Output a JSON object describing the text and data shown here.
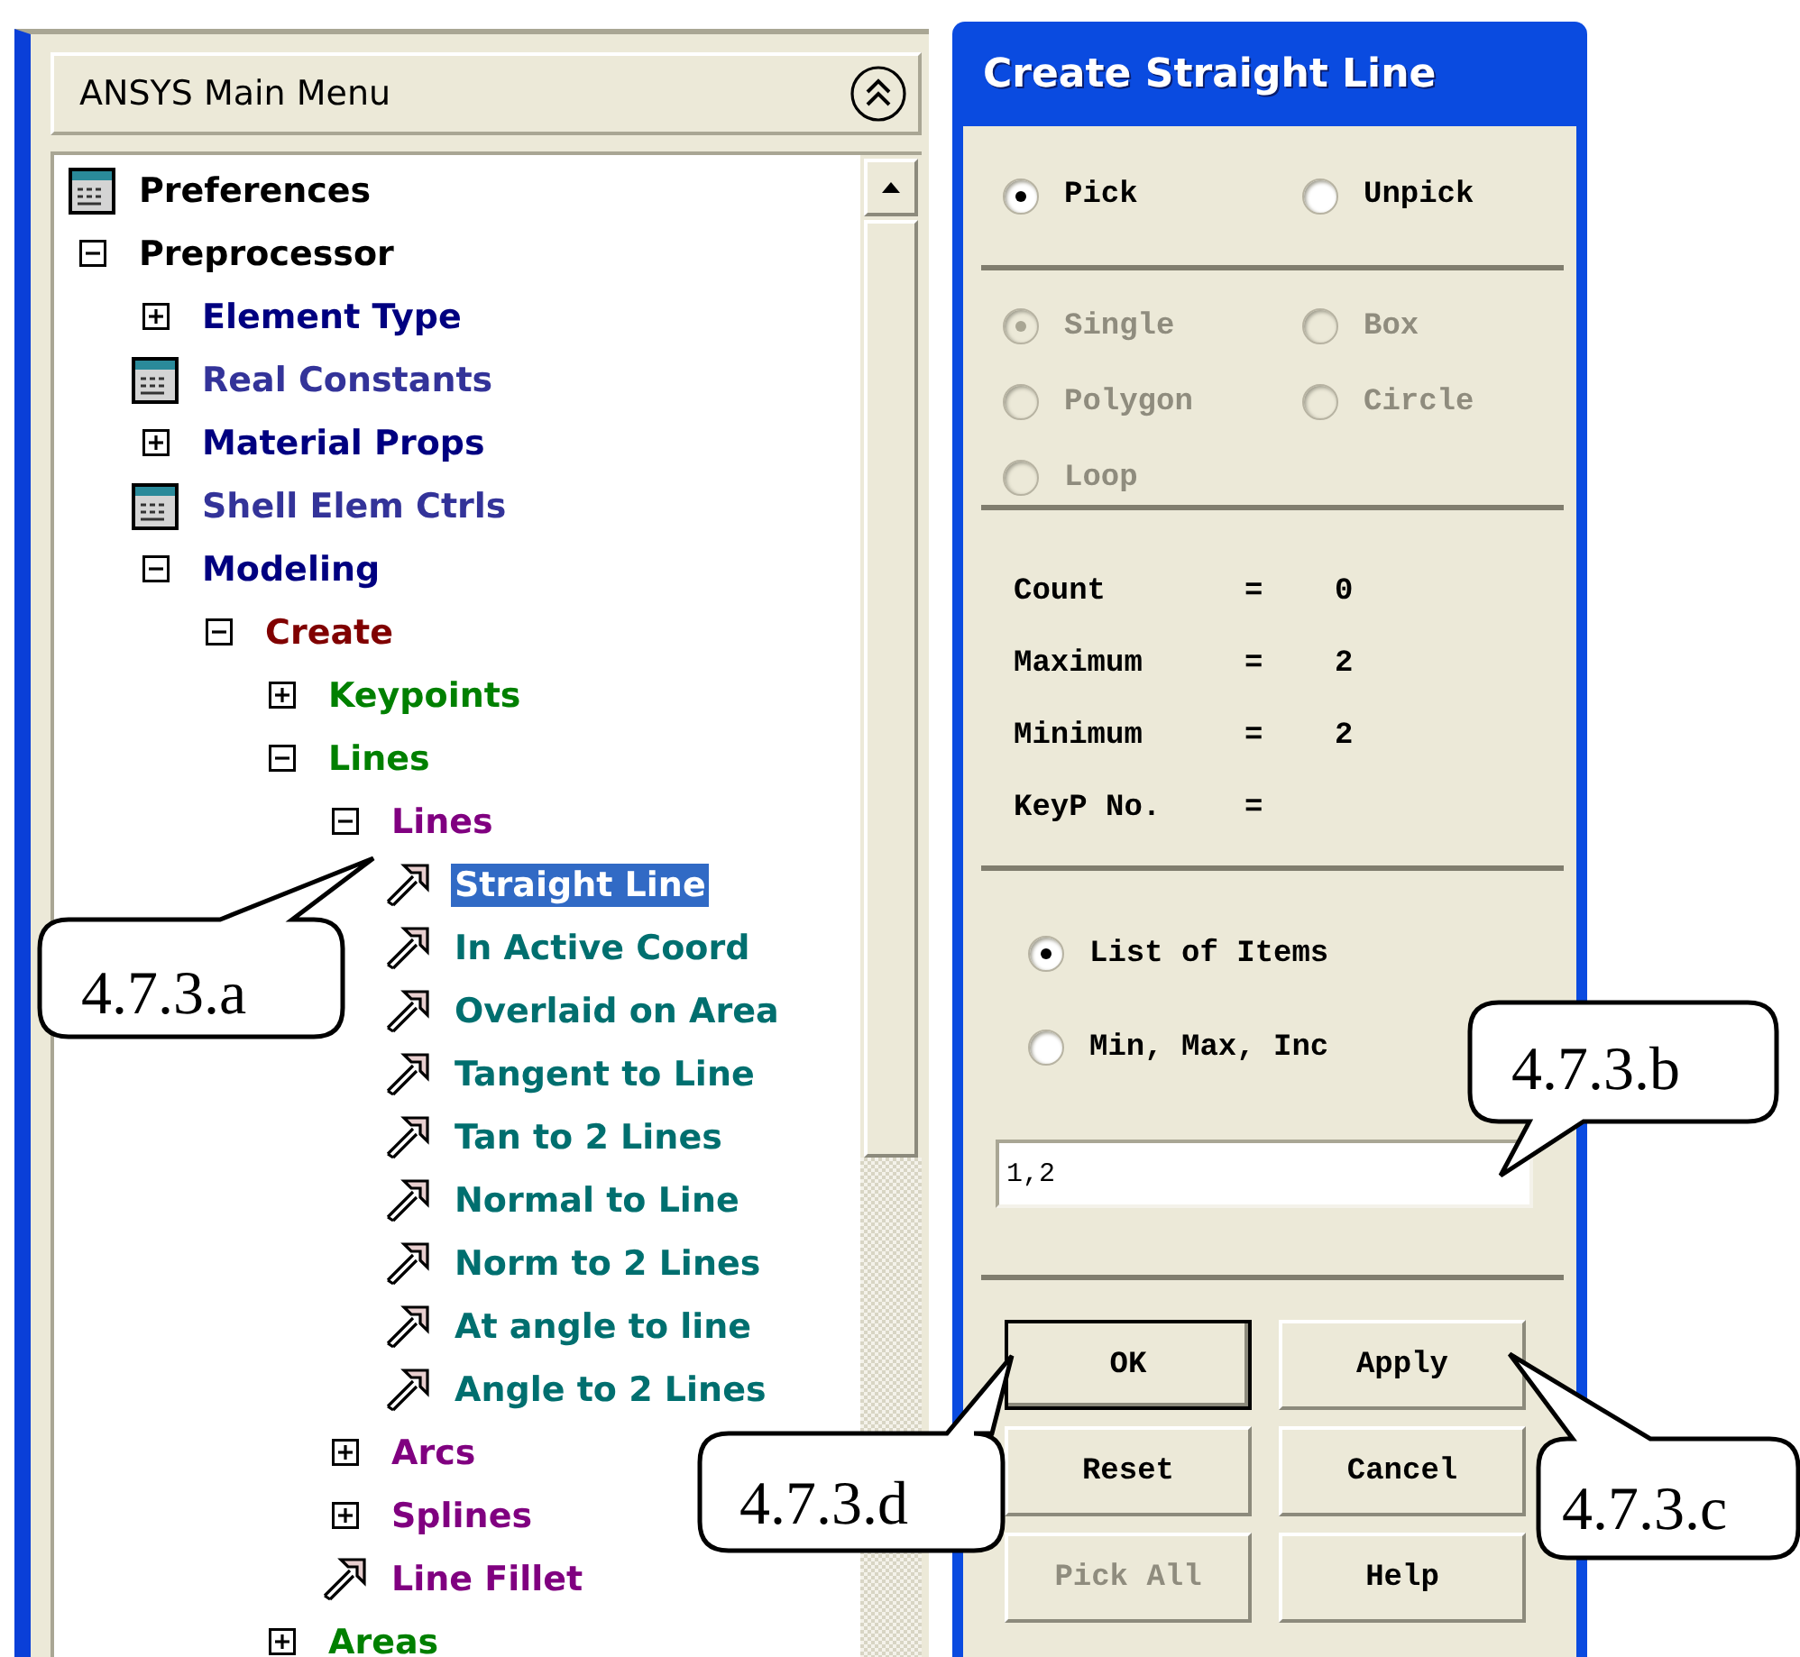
{
  "main_menu": {
    "title": "ANSYS Main Menu",
    "tree": [
      {
        "label": "Preferences",
        "kind": "dialog",
        "color": "#000000",
        "selected": false
      },
      {
        "label": "Preprocessor",
        "kind": "folder",
        "expanded": true,
        "color": "#000000",
        "selected": false,
        "children": [
          {
            "label": "Element Type",
            "kind": "folder",
            "expanded": false,
            "color": "#000080",
            "selected": false
          },
          {
            "label": "Real Constants",
            "kind": "dialog",
            "color": "#333399",
            "selected": false
          },
          {
            "label": "Material Props",
            "kind": "folder",
            "expanded": false,
            "color": "#000080",
            "selected": false
          },
          {
            "label": "Shell Elem Ctrls",
            "kind": "dialog",
            "color": "#333399",
            "selected": false
          },
          {
            "label": "Modeling",
            "kind": "folder",
            "expanded": true,
            "color": "#000080",
            "selected": false,
            "children": [
              {
                "label": "Create",
                "kind": "folder",
                "expanded": true,
                "color": "#800000",
                "selected": false,
                "children": [
                  {
                    "label": "Keypoints",
                    "kind": "folder",
                    "expanded": false,
                    "color": "#008000",
                    "selected": false
                  },
                  {
                    "label": "Lines",
                    "kind": "folder",
                    "expanded": true,
                    "color": "#008000",
                    "selected": false,
                    "children": [
                      {
                        "label": "Lines",
                        "kind": "folder",
                        "expanded": true,
                        "color": "#800080",
                        "selected": false,
                        "children": [
                          {
                            "label": "Straight Line",
                            "kind": "action",
                            "selected": true
                          },
                          {
                            "label": "In Active Coord",
                            "kind": "action",
                            "color": "#006f6f",
                            "selected": false
                          },
                          {
                            "label": "Overlaid on Area",
                            "kind": "action",
                            "color": "#006f6f",
                            "selected": false
                          },
                          {
                            "label": "Tangent to Line",
                            "kind": "action",
                            "color": "#006f6f",
                            "selected": false
                          },
                          {
                            "label": "Tan to 2 Lines",
                            "kind": "action",
                            "color": "#006f6f",
                            "selected": false
                          },
                          {
                            "label": "Normal to Line",
                            "kind": "action",
                            "color": "#006f6f",
                            "selected": false
                          },
                          {
                            "label": "Norm to 2 Lines",
                            "kind": "action",
                            "color": "#006f6f",
                            "selected": false
                          },
                          {
                            "label": "At angle to line",
                            "kind": "action",
                            "color": "#006f6f",
                            "selected": false
                          },
                          {
                            "label": "Angle to 2 Lines",
                            "kind": "action",
                            "color": "#006f6f",
                            "selected": false
                          }
                        ]
                      },
                      {
                        "label": "Arcs",
                        "kind": "folder",
                        "expanded": false,
                        "color": "#800080",
                        "selected": false
                      },
                      {
                        "label": "Splines",
                        "kind": "folder",
                        "expanded": false,
                        "color": "#800080",
                        "selected": false
                      },
                      {
                        "label": "Line Fillet",
                        "kind": "action",
                        "color": "#800080",
                        "selected": false
                      }
                    ]
                  },
                  {
                    "label": "Areas",
                    "kind": "folder",
                    "expanded": false,
                    "color": "#008000",
                    "selected": false
                  }
                ]
              }
            ]
          }
        ]
      }
    ]
  },
  "dialog": {
    "title": "Create Straight Line",
    "pick_mode": [
      {
        "label": "Pick",
        "selected": true,
        "disabled": false
      },
      {
        "label": "Unpick",
        "selected": false,
        "disabled": false
      }
    ],
    "pick_shape": [
      {
        "label": "Single",
        "selected": true,
        "disabled": true
      },
      {
        "label": "Box",
        "selected": false,
        "disabled": true
      },
      {
        "label": "Polygon",
        "selected": false,
        "disabled": true
      },
      {
        "label": "Circle",
        "selected": false,
        "disabled": true
      },
      {
        "label": "Loop",
        "selected": false,
        "disabled": true
      }
    ],
    "info": [
      {
        "label": "Count",
        "separator": "=",
        "value": "0"
      },
      {
        "label": "Maximum",
        "separator": "=",
        "value": "2"
      },
      {
        "label": "Minimum",
        "separator": "=",
        "value": "2"
      },
      {
        "label": "KeyP No.",
        "separator": "="
      }
    ],
    "entry_mode": [
      {
        "label": "List of Items",
        "selected": true,
        "disabled": false
      },
      {
        "label": "Min, Max, Inc",
        "selected": false,
        "disabled": false
      }
    ],
    "input": {
      "value": "1,2"
    },
    "buttons": [
      {
        "label": "OK",
        "focused": true,
        "disabled": false
      },
      {
        "label": "Apply",
        "focused": false,
        "disabled": false
      },
      {
        "label": "Reset",
        "focused": false,
        "disabled": false
      },
      {
        "label": "Cancel",
        "focused": false,
        "disabled": false
      },
      {
        "label": "Pick All",
        "focused": false,
        "disabled": true
      },
      {
        "label": "Help",
        "focused": false,
        "disabled": false
      }
    ]
  },
  "callouts": [
    {
      "text": "4.7.3.a"
    },
    {
      "text": "4.7.3.b"
    },
    {
      "text": "4.7.3.c"
    },
    {
      "text": "4.7.3.d"
    }
  ]
}
